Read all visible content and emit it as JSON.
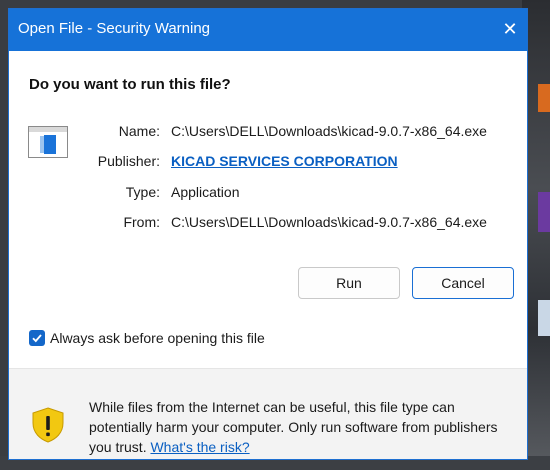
{
  "dialog": {
    "title": "Open File - Security Warning",
    "close_glyph": "✕",
    "heading": "Do you want to run this file?",
    "file_icon": "application-window-icon",
    "fields": {
      "name_label": "Name:",
      "name_value": "C:\\Users\\DELL\\Downloads\\kicad-9.0.7-x86_64.exe",
      "publisher_label": "Publisher:",
      "publisher_value": "KICAD SERVICES CORPORATION",
      "type_label": "Type:",
      "type_value": "Application",
      "from_label": "From:",
      "from_value": "C:\\Users\\DELL\\Downloads\\kicad-9.0.7-x86_64.exe"
    },
    "buttons": {
      "run": "Run",
      "cancel": "Cancel"
    },
    "always_ask": {
      "label": "Always ask before opening this file",
      "checked": true
    },
    "footer": {
      "warning_text": "While files from the Internet can be useful, this file type can potentially harm your computer. Only run software from publishers you trust. ",
      "risk_link": "What's the risk?",
      "icon": "shield-warning-icon"
    }
  },
  "colors": {
    "titlebar": "#1672d8",
    "link": "#0a5fc2",
    "checkbox": "#1467c9",
    "shield": "#f2c811"
  }
}
